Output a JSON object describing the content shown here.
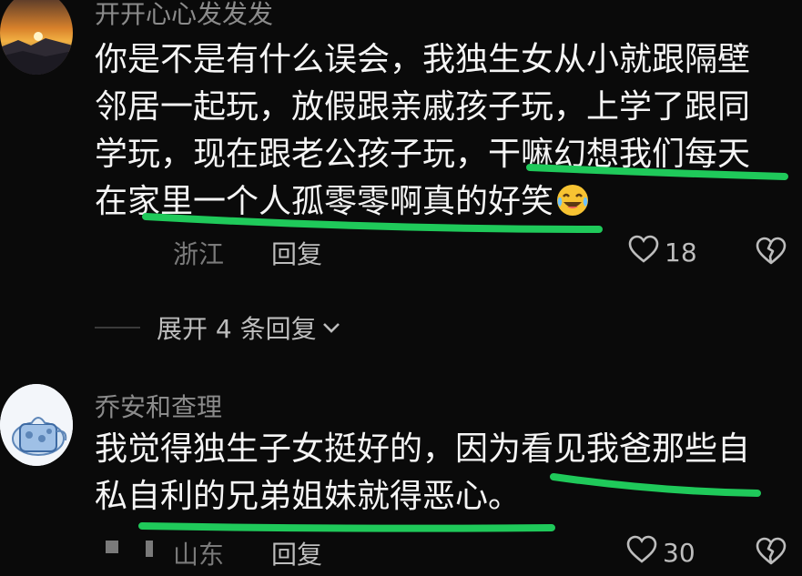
{
  "comments": [
    {
      "username": "开开心心发发发",
      "lines": [
        "你是不是有什么误会，我独生女从小就跟隔壁",
        "邻居一起玩，放假跟亲戚孩子玩，上学了跟同",
        "学玩，现在跟老公孩子玩，干嘛幻想我们每天",
        "在家里一个人孤零零啊真的好笑"
      ],
      "emoji": "laughing-crying-emoji",
      "location": "浙江",
      "reply_label": "回复",
      "likes": "18"
    },
    {
      "username": "乔安和查理",
      "lines": [
        "我觉得独生子女挺好的，因为看见我爸那些自",
        "私自利的兄弟姐妹就得恶心。"
      ],
      "location": "山东",
      "reply_label": "回复",
      "likes": "30"
    }
  ],
  "expand_replies": "展开 4 条回复",
  "colors": {
    "background": "#0a0a0a",
    "text": "#f5f5f5",
    "muted": "#8b8b8b",
    "highlight_underline": "#1fc95a"
  },
  "icons": [
    "heart-icon",
    "broken-heart-icon",
    "chevron-down-icon"
  ]
}
